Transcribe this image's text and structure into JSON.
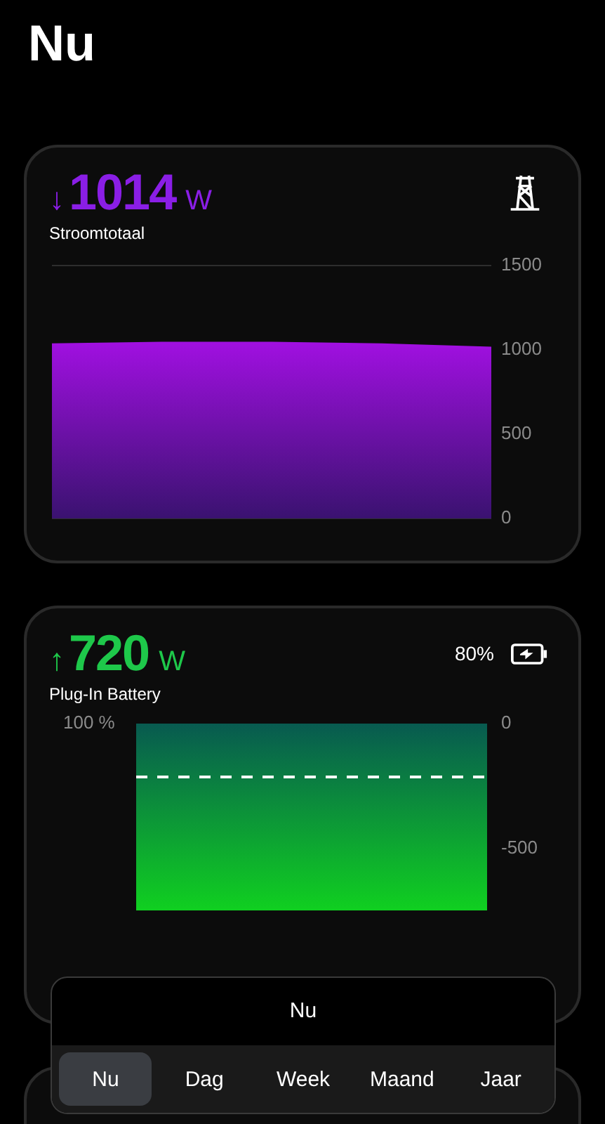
{
  "title": "Nu",
  "cards": [
    {
      "kind": "grid",
      "arrow": "↓",
      "value": "1014",
      "unit": "W",
      "color": "#8a1ee6",
      "label": "Stroomtotaal",
      "chart_data": {
        "type": "area",
        "values": [
          1030,
          1040,
          1040,
          1030,
          1010
        ],
        "color": "#a010e0",
        "ylim": [
          0,
          1500
        ],
        "yticks": [
          0,
          500,
          1000,
          1500
        ]
      }
    },
    {
      "kind": "battery",
      "arrow": "↑",
      "value": "720",
      "unit": "W",
      "color": "#1ec84a",
      "label": "Plug-In Battery",
      "charge": "80%",
      "charging": true,
      "left_axis_label": "100 %",
      "right_axis_labels": [
        "0",
        "-500"
      ]
    }
  ],
  "period_picker": {
    "title": "Nu",
    "options": [
      {
        "label": "Nu",
        "selected": true
      },
      {
        "label": "Dag",
        "selected": false
      },
      {
        "label": "Week",
        "selected": false
      },
      {
        "label": "Maand",
        "selected": false
      },
      {
        "label": "Jaar",
        "selected": false
      }
    ]
  }
}
